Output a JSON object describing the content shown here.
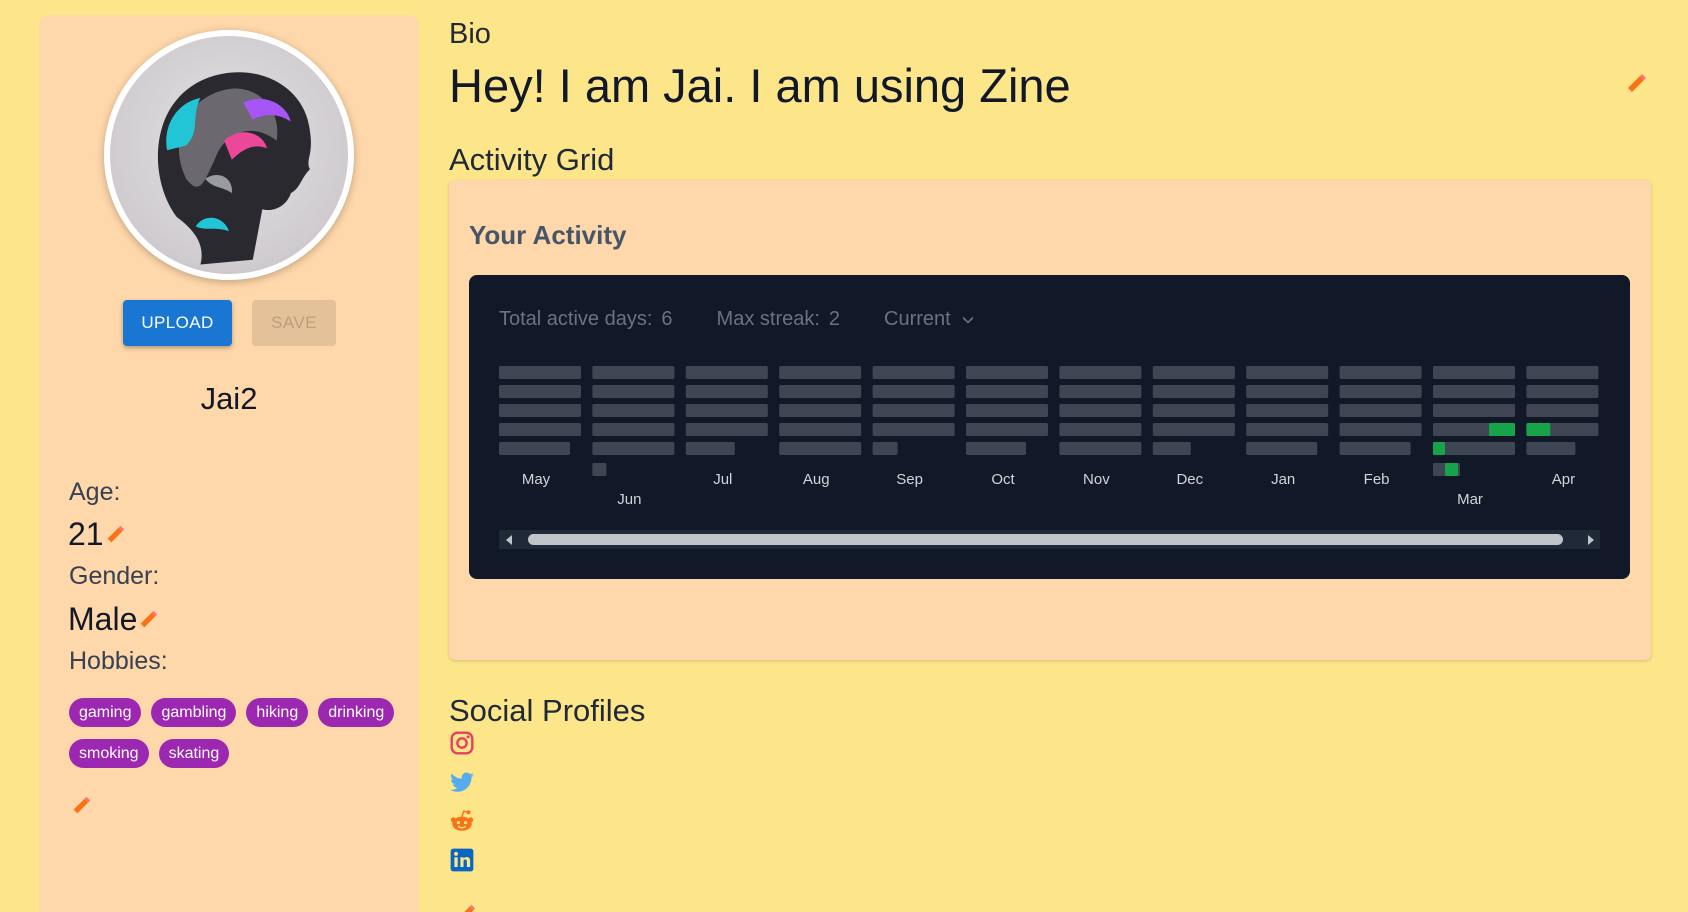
{
  "profile": {
    "upload_label": "UPLOAD",
    "save_label": "SAVE",
    "username": "Jai2",
    "age_label": "Age:",
    "age_value": "21",
    "gender_label": "Gender:",
    "gender_value": "Male",
    "hobbies_label": "Hobbies:",
    "hobbies": [
      "gaming",
      "gambling",
      "hiking",
      "drinking",
      "smoking",
      "skating"
    ]
  },
  "bio": {
    "label": "Bio",
    "text": "Hey! I am Jai. I am using Zine"
  },
  "activity": {
    "section_title": "Activity Grid",
    "card_title": "Your Activity",
    "total_label": "Total active days:",
    "total_value": "6",
    "streak_label": "Max streak:",
    "streak_value": "2",
    "range_label": "Current",
    "months": [
      "May",
      "Jun",
      "Jul",
      "Aug",
      "Sep",
      "Oct",
      "Nov",
      "Dec",
      "Jan",
      "Feb",
      "Mar",
      "Apr"
    ],
    "colors": {
      "empty": "#3f4653",
      "active": "#16a34a",
      "panel": "#111827"
    }
  },
  "social": {
    "title": "Social Profiles",
    "icons": [
      "instagram-icon",
      "twitter-icon",
      "reddit-icon",
      "linkedin-icon"
    ],
    "colors": {
      "instagram": "#e4405f",
      "twitter": "#55acee",
      "reddit": "#f97316",
      "linkedin": "#0a66c2"
    }
  },
  "theme": {
    "page_bg": "#fde68a",
    "card_bg": "#fed7aa",
    "primary": "#1976d2",
    "chip": "#9c27b0",
    "pencil": "#f97316"
  }
}
